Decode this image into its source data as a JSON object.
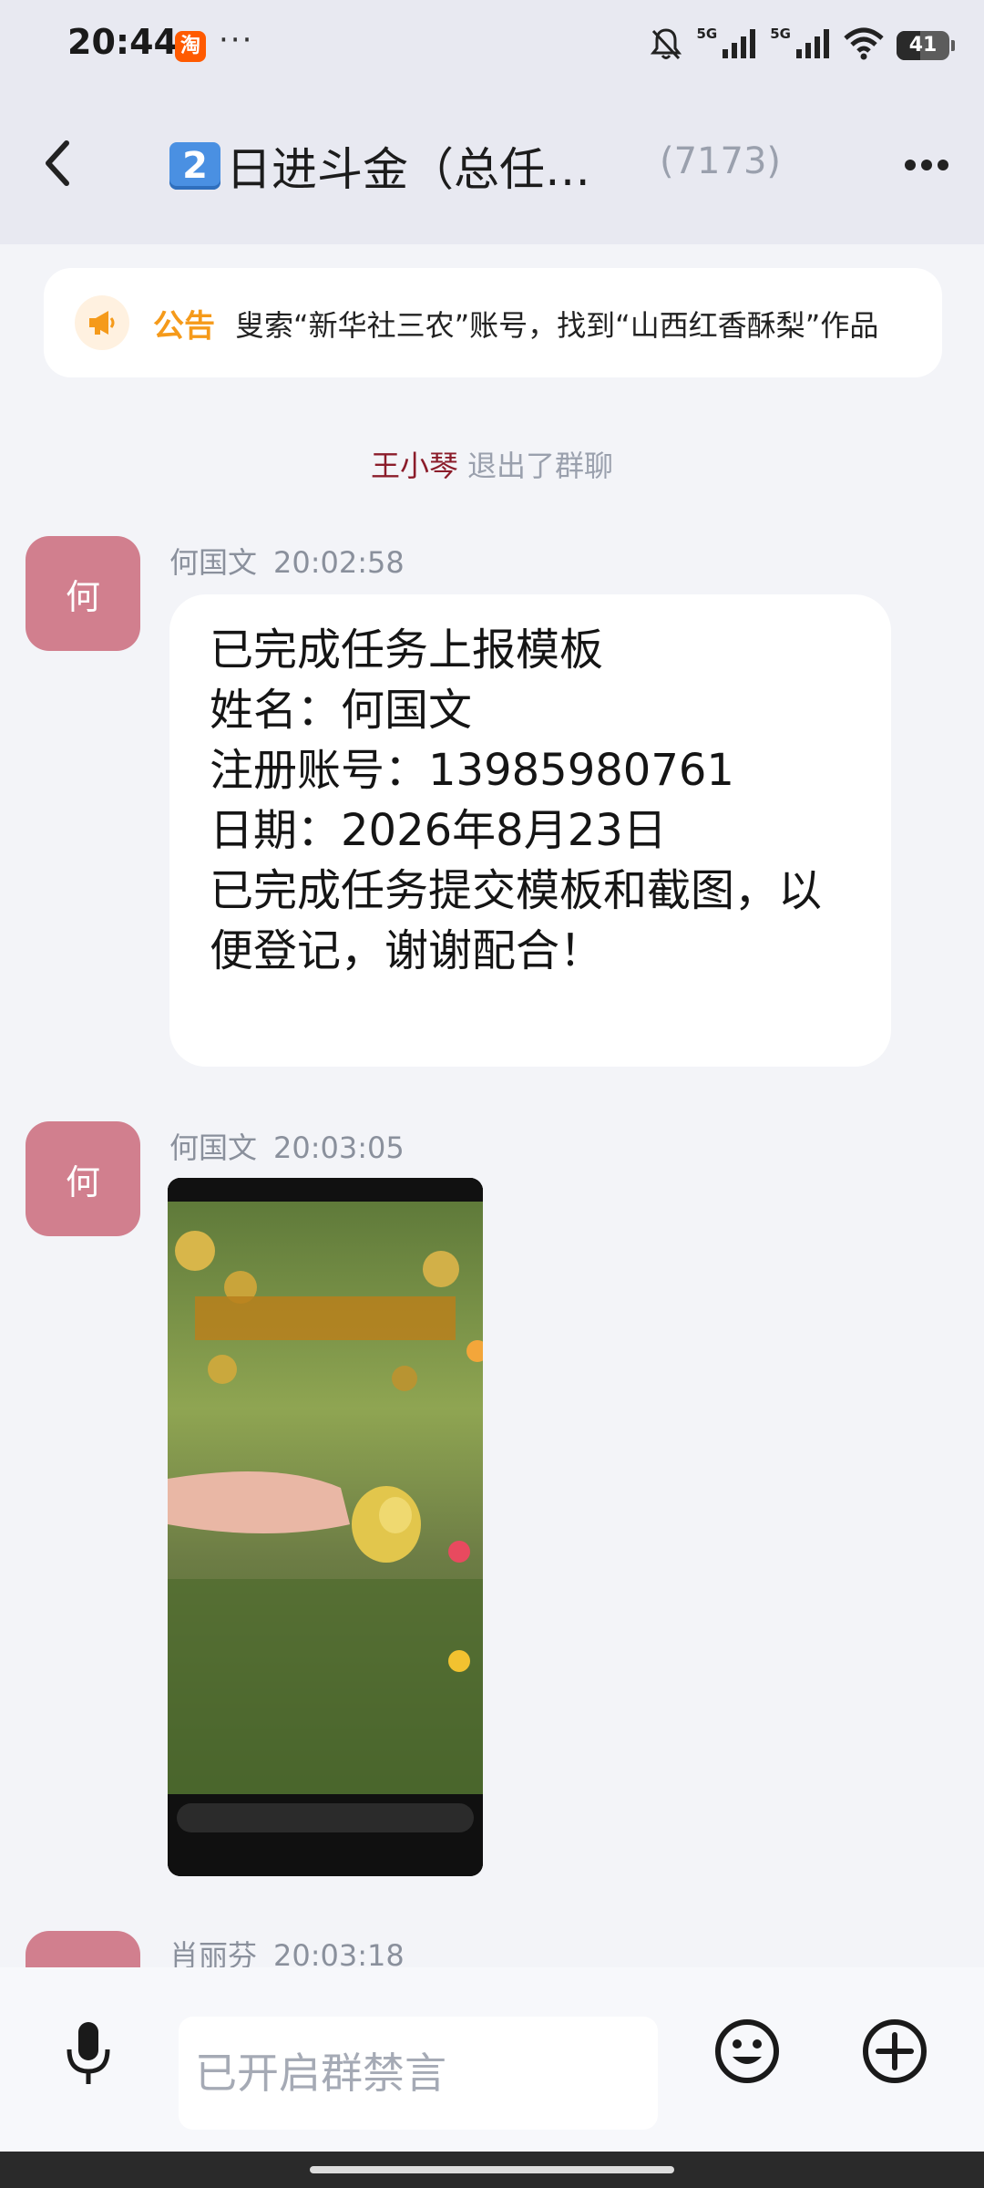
{
  "status_bar": {
    "time": "20:44",
    "app_badge": "淘",
    "more": "···",
    "signal_label_1": "5G",
    "signal_label_2": "5G",
    "battery": "41"
  },
  "header": {
    "title_emoji": "2",
    "title": "日进斗金（总任…",
    "member_count": "(7173)"
  },
  "announcement": {
    "label": "公告",
    "text": "叟索“新华社三农”账号，找到“山西红香酥梨”作品"
  },
  "system_message": {
    "name": "王小琴",
    "text": "退出了群聊"
  },
  "messages": [
    {
      "avatar": "何",
      "sender": "何国文",
      "time": "20:02:58",
      "lines": [
        "已完成任务上报模板",
        "",
        "姓名：何国文",
        "注册账号：13985980761",
        "日期：2026年8月23日",
        "已完成任务提交模板和截图，以",
        "便登记，谢谢配合！"
      ]
    },
    {
      "avatar": "何",
      "sender": "何国文",
      "time": "20:03:05"
    },
    {
      "sender": "肖丽芬",
      "time": "20:03:18"
    }
  ],
  "input_bar": {
    "placeholder": "已开启群禁言"
  },
  "colors": {
    "accent_orange": "#f59a1a",
    "avatar_pink": "#d17f8e",
    "system_name": "#8b1c2a"
  }
}
